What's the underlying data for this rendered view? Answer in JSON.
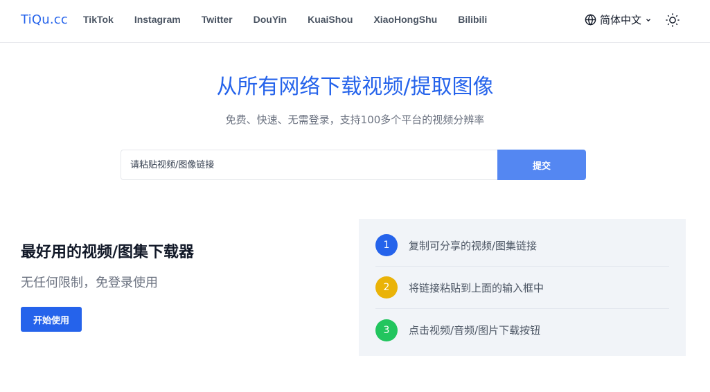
{
  "header": {
    "logo": "TiQu.cc",
    "nav": [
      "TikTok",
      "Instagram",
      "Twitter",
      "DouYin",
      "KuaiShou",
      "XiaoHongShu",
      "Bilibili"
    ],
    "language": "简体中文",
    "icons": {
      "language": "globe-icon",
      "dropdown": "chevron-down-icon",
      "theme": "sun-icon"
    }
  },
  "hero": {
    "title": "从所有网络下载视频/提取图像",
    "subtitle": "免费、快速、无需登录，支持100多个平台的视频分辨率"
  },
  "search": {
    "placeholder": "请粘贴视频/图像链接",
    "value": "",
    "submit_label": "提交"
  },
  "feature": {
    "title": "最好用的视频/图集下载器",
    "subtitle": "无任何限制，免登录使用",
    "cta_label": "开始使用"
  },
  "steps": [
    {
      "number": "1",
      "text": "复制可分享的视频/图集链接",
      "color": "#2563eb"
    },
    {
      "number": "2",
      "text": "将链接粘贴到上面的输入框中",
      "color": "#eab308"
    },
    {
      "number": "3",
      "text": "点击视频/音频/图片下载按钮",
      "color": "#22c55e"
    }
  ],
  "colors": {
    "brand": "#2563eb",
    "submit": "#5487f2",
    "panel_bg": "#f1f4f8"
  }
}
